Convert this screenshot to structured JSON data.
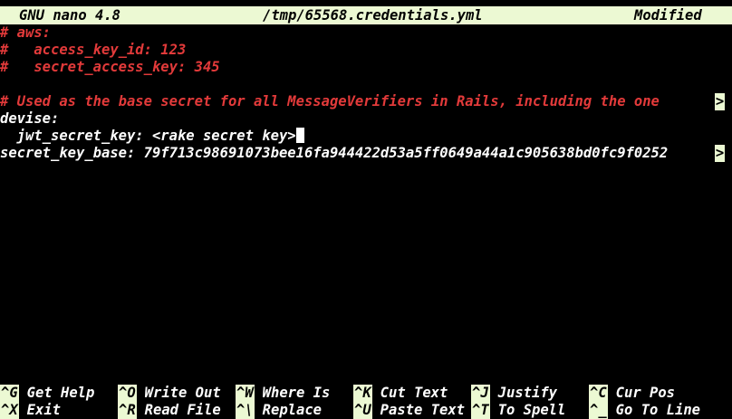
{
  "titlebar": {
    "app": "GNU nano 4.8",
    "filename": "/tmp/65568.credentials.yml",
    "status": "Modified"
  },
  "editor": {
    "lines": [
      "# aws:",
      "#   access_key_id: 123",
      "#   secret_access_key: 345",
      "",
      "# Used as the base secret for all MessageVerifiers in Rails, including the one",
      "devise:",
      "  jwt_secret_key: <rake secret key>",
      "secret_key_base: 79f713c98691073bee16fa944422d53a5ff0649a44a1c905638bd0fc9f0252"
    ],
    "continuation_marker": ">"
  },
  "shortcuts": {
    "row1": [
      {
        "key": "^G",
        "label": "Get Help"
      },
      {
        "key": "^O",
        "label": "Write Out"
      },
      {
        "key": "^W",
        "label": "Where Is"
      },
      {
        "key": "^K",
        "label": "Cut Text"
      },
      {
        "key": "^J",
        "label": "Justify"
      },
      {
        "key": "^C",
        "label": "Cur Pos"
      }
    ],
    "row2": [
      {
        "key": "^X",
        "label": "Exit"
      },
      {
        "key": "^R",
        "label": "Read File"
      },
      {
        "key": "^\\",
        "label": "Replace"
      },
      {
        "key": "^U",
        "label": "Paste Text"
      },
      {
        "key": "^T",
        "label": "To Spell"
      },
      {
        "key": "^_",
        "label": "Go To Line"
      }
    ]
  },
  "colors": {
    "bar_bg": "#ecf9d3",
    "comment": "#e23a3a",
    "text": "#ffffff",
    "background": "#000000"
  }
}
